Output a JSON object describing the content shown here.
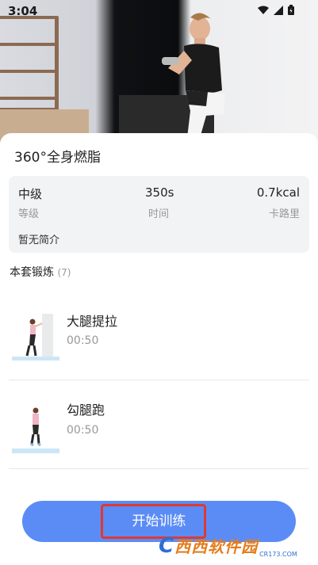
{
  "status_bar": {
    "time": "3:04"
  },
  "workout": {
    "title": "360°全身燃脂",
    "stats": [
      {
        "value": "中级",
        "label": "等级"
      },
      {
        "value": "350s",
        "label": "时间"
      },
      {
        "value": "0.7kcal",
        "label": "卡路里"
      }
    ],
    "description": "暂无简介"
  },
  "section": {
    "title": "本套锻炼",
    "count": "(7)"
  },
  "exercises": [
    {
      "name": "大腿提拉",
      "duration": "00:50"
    },
    {
      "name": "勾腿跑",
      "duration": "00:50"
    }
  ],
  "start_button": {
    "label": "开始训练"
  },
  "watermark": {
    "brand": "西西软件园",
    "site": "CR173.COM"
  },
  "colors": {
    "accent": "#5b8cf6",
    "highlight": "#e0392f"
  }
}
